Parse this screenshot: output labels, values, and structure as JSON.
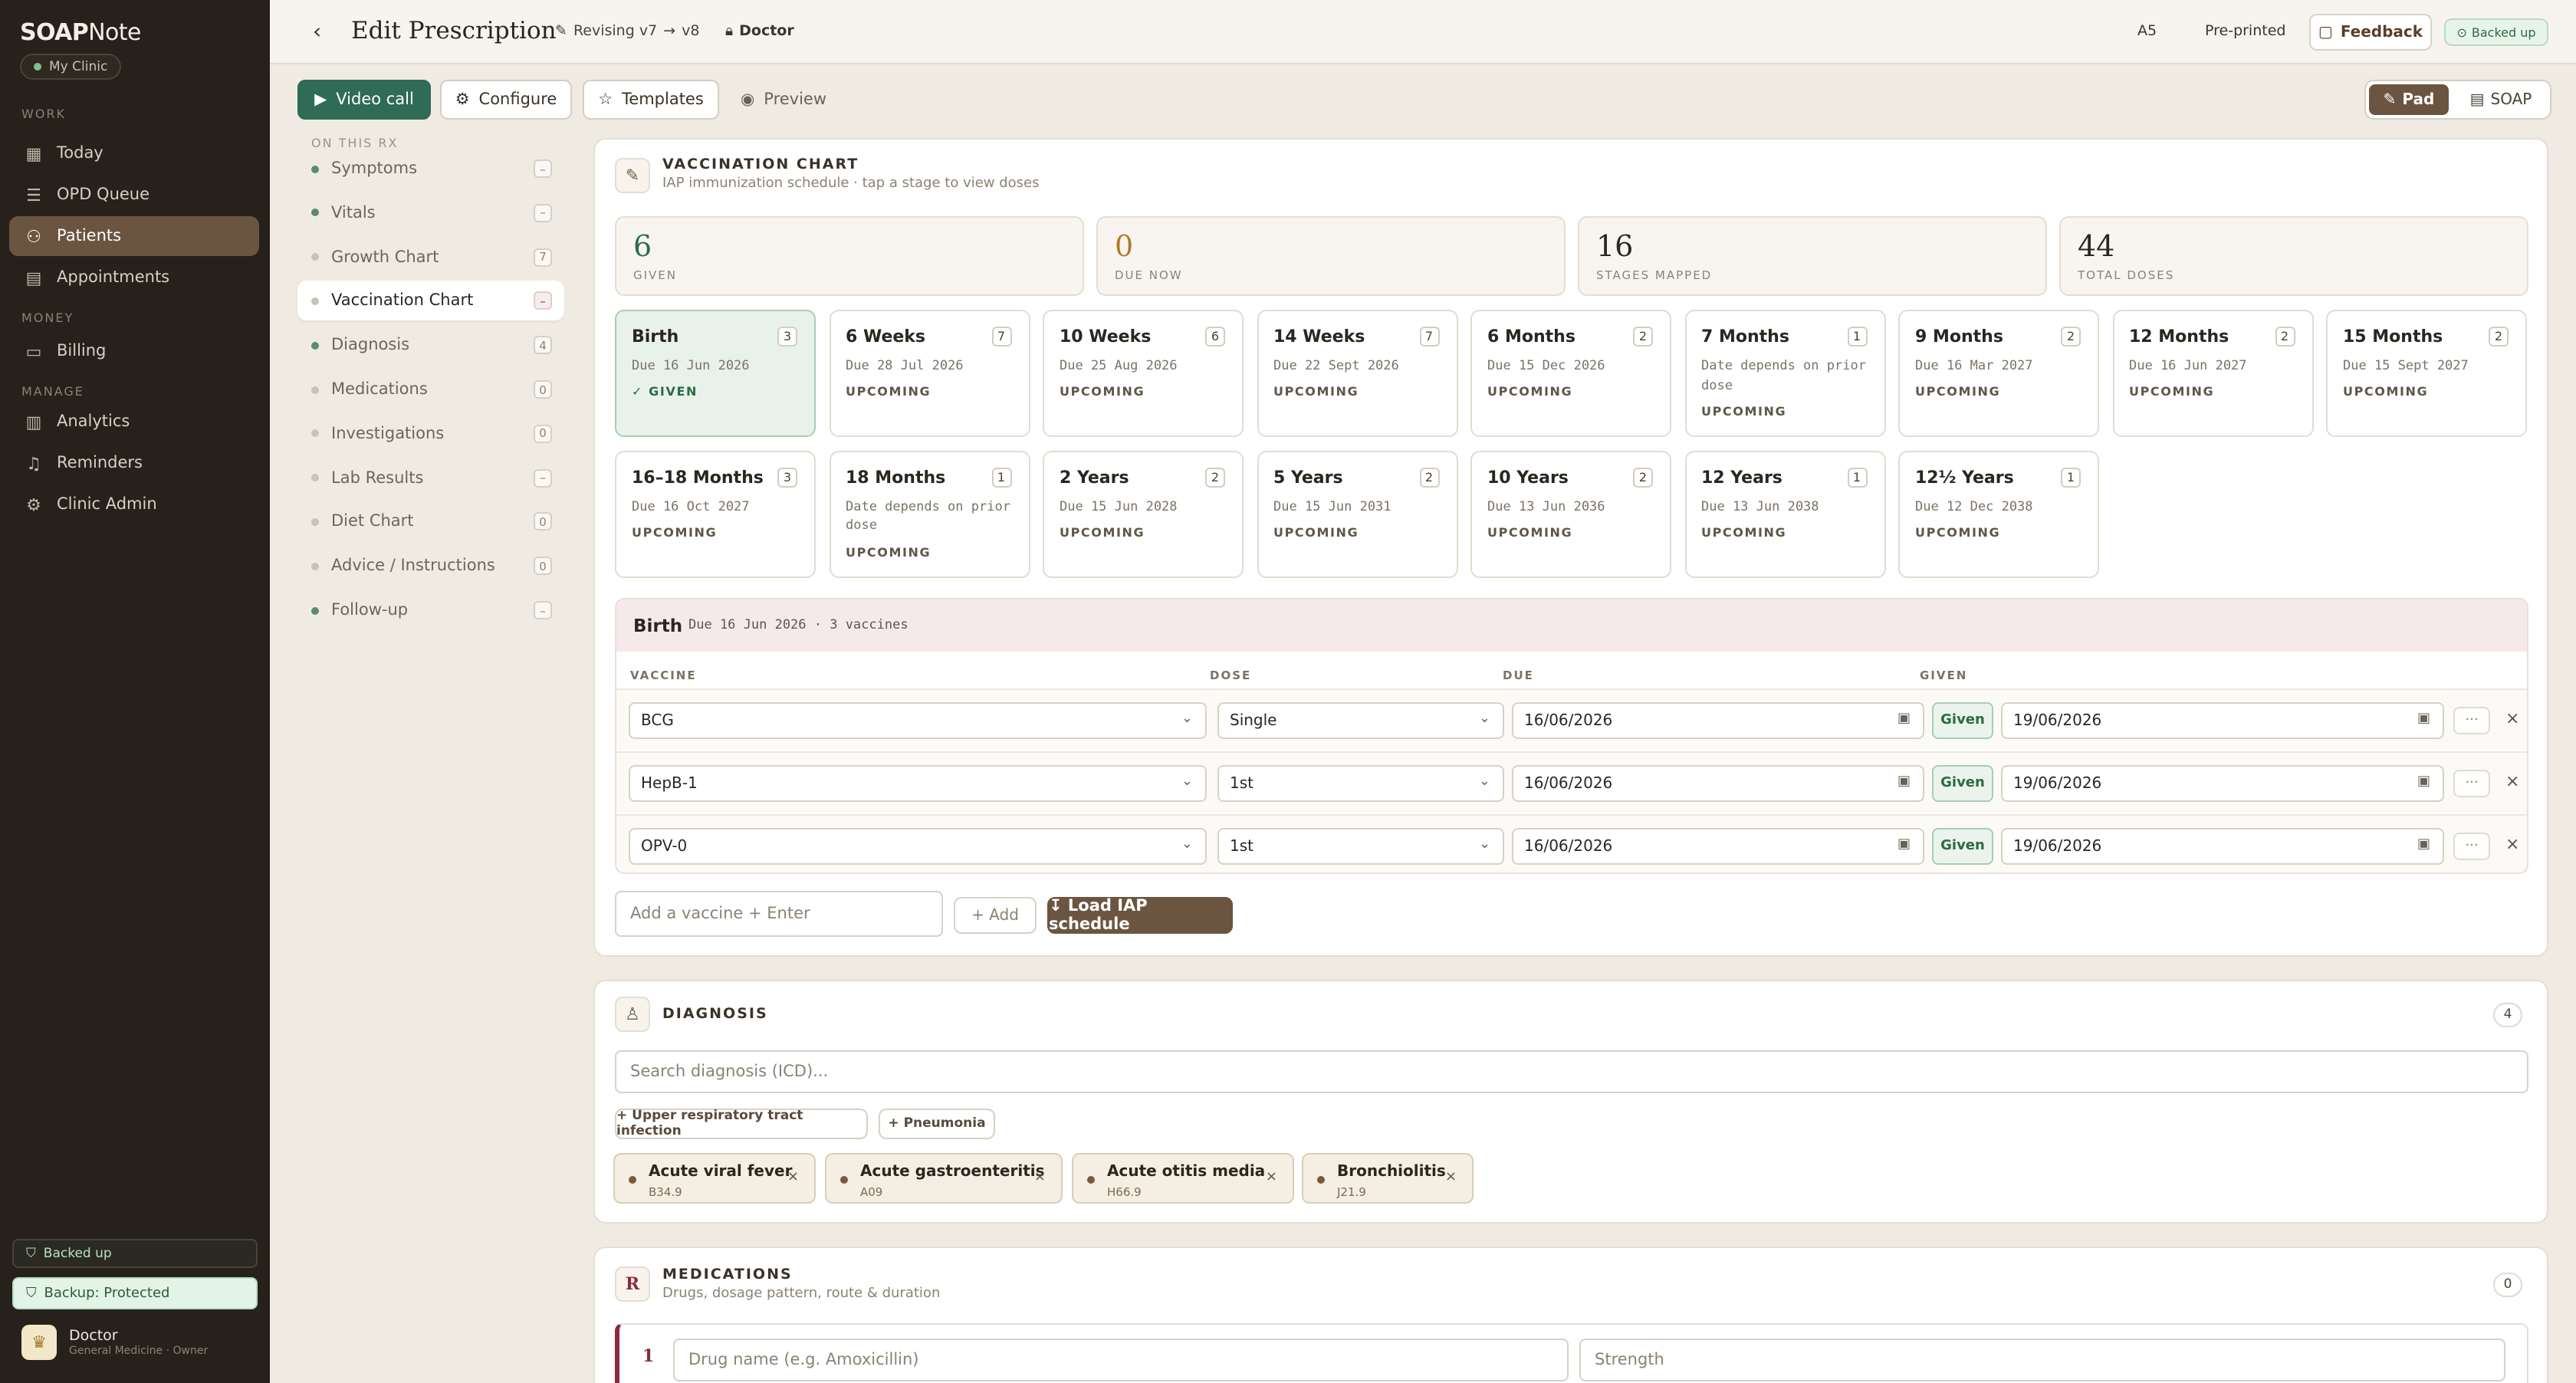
{
  "sidebar": {
    "brand_a": "SOAP",
    "brand_b": "Note",
    "clinic": "My Clinic",
    "sections": [
      "WORK",
      "MONEY",
      "MANAGE"
    ],
    "items": [
      {
        "label": "Today",
        "icon": "grid-icon"
      },
      {
        "label": "OPD Queue",
        "icon": "list-icon"
      },
      {
        "label": "Patients",
        "icon": "users-icon",
        "active": true
      },
      {
        "label": "Appointments",
        "icon": "calendar-icon"
      },
      {
        "label": "Billing",
        "icon": "receipt-icon"
      },
      {
        "label": "Analytics",
        "icon": "bar-chart-icon"
      },
      {
        "label": "Reminders",
        "icon": "bell-icon"
      },
      {
        "label": "Clinic Admin",
        "icon": "gear-icon"
      }
    ],
    "backed_up": "Backed up",
    "backup_protected": "Backup: Protected",
    "user_name": "Doctor",
    "user_role": "General Medicine · Owner"
  },
  "topbar": {
    "title": "Edit Prescription",
    "revising": "Revising v7",
    "arrow": "→",
    "version": "v8",
    "role": "Doctor",
    "paper": "A5",
    "preprinted": "Pre-printed",
    "feedback": "Feedback",
    "backed_up": "Backed up"
  },
  "toolbar": {
    "video_call": "Video call",
    "configure": "Configure",
    "templates": "Templates",
    "preview": "Preview",
    "pad": "Pad",
    "soap": "SOAP"
  },
  "rxnav": {
    "heading": "ON THIS RX",
    "items": [
      {
        "label": "Symptoms",
        "count": "–",
        "filled": true
      },
      {
        "label": "Vitals",
        "count": "–",
        "filled": true
      },
      {
        "label": "Growth Chart",
        "count": "7",
        "filled": false
      },
      {
        "label": "Vaccination Chart",
        "count": "–",
        "filled": false,
        "active": true
      },
      {
        "label": "Diagnosis",
        "count": "4",
        "filled": true
      },
      {
        "label": "Medications",
        "count": "0",
        "filled": false
      },
      {
        "label": "Investigations",
        "count": "0",
        "filled": false
      },
      {
        "label": "Lab Results",
        "count": "–",
        "filled": false
      },
      {
        "label": "Diet Chart",
        "count": "0",
        "filled": false
      },
      {
        "label": "Advice / Instructions",
        "count": "0",
        "filled": false
      },
      {
        "label": "Follow-up",
        "count": "–",
        "filled": true
      }
    ]
  },
  "vaccination": {
    "title": "VACCINATION CHART",
    "subtitle": "IAP immunization schedule · tap a stage to view doses",
    "stats": [
      {
        "value": "6",
        "label": "GIVEN",
        "color": "#2d6b4f"
      },
      {
        "value": "0",
        "label": "DUE NOW",
        "color": "#b07a2a"
      },
      {
        "value": "16",
        "label": "STAGES MAPPED",
        "color": "#2b2620"
      },
      {
        "value": "44",
        "label": "TOTAL DOSES",
        "color": "#2b2620"
      }
    ],
    "stages": [
      {
        "name": "Birth",
        "count": "3",
        "due": "Due 16 Jun 2026",
        "status": "✓ GIVEN",
        "given": true
      },
      {
        "name": "6 Weeks",
        "count": "7",
        "due": "Due 28 Jul 2026",
        "status": "UPCOMING"
      },
      {
        "name": "10 Weeks",
        "count": "6",
        "due": "Due 25 Aug 2026",
        "status": "UPCOMING"
      },
      {
        "name": "14 Weeks",
        "count": "7",
        "due": "Due 22 Sept 2026",
        "status": "UPCOMING"
      },
      {
        "name": "6 Months",
        "count": "2",
        "due": "Due 15 Dec 2026",
        "status": "UPCOMING"
      },
      {
        "name": "7 Months",
        "count": "1",
        "due": "Date depends on prior dose",
        "status": "UPCOMING",
        "two_line": true
      },
      {
        "name": "9 Months",
        "count": "2",
        "due": "Due 16 Mar 2027",
        "status": "UPCOMING"
      },
      {
        "name": "12 Months",
        "count": "2",
        "due": "Due 16 Jun 2027",
        "status": "UPCOMING"
      },
      {
        "name": "15 Months",
        "count": "2",
        "due": "Due 15 Sept 2027",
        "status": "UPCOMING"
      },
      {
        "name": "16–18 Months",
        "count": "3",
        "due": "Due 16 Oct 2027",
        "status": "UPCOMING"
      },
      {
        "name": "18 Months",
        "count": "1",
        "due": "Date depends on prior dose",
        "status": "UPCOMING",
        "two_line": true
      },
      {
        "name": "2 Years",
        "count": "2",
        "due": "Due 15 Jun 2028",
        "status": "UPCOMING"
      },
      {
        "name": "5 Years",
        "count": "2",
        "due": "Due 15 Jun 2031",
        "status": "UPCOMING"
      },
      {
        "name": "10 Years",
        "count": "2",
        "due": "Due 13 Jun 2036",
        "status": "UPCOMING"
      },
      {
        "name": "12 Years",
        "count": "1",
        "due": "Due 13 Jun 2038",
        "status": "UPCOMING"
      },
      {
        "name": "12½ Years",
        "count": "1",
        "due": "Due 12 Dec 2038",
        "status": "UPCOMING"
      }
    ],
    "detail": {
      "stage": "Birth",
      "meta": "Due 16 Jun 2026 · 3 vaccines",
      "columns": [
        "VACCINE",
        "DOSE",
        "DUE",
        "GIVEN"
      ],
      "rows": [
        {
          "vaccine": "BCG",
          "dose": "Single",
          "due": "16/06/2026",
          "status": "Given",
          "given": "19/06/2026"
        },
        {
          "vaccine": "HepB-1",
          "dose": "1st",
          "due": "16/06/2026",
          "status": "Given",
          "given": "19/06/2026"
        },
        {
          "vaccine": "OPV-0",
          "dose": "1st",
          "due": "16/06/2026",
          "status": "Given",
          "given": "19/06/2026"
        }
      ]
    },
    "add_placeholder": "Add a vaccine + Enter",
    "add_label": "+ Add",
    "load_label": "↧ Load IAP schedule"
  },
  "diagnosis": {
    "title": "DIAGNOSIS",
    "count": "4",
    "search_placeholder": "Search diagnosis (ICD)...",
    "suggestions": [
      "+ Upper respiratory tract infection",
      "+ Pneumonia"
    ],
    "items": [
      {
        "name": "Acute viral fever",
        "code": "B34.9"
      },
      {
        "name": "Acute gastroenteritis",
        "code": "A09"
      },
      {
        "name": "Acute otitis media",
        "code": "H66.9"
      },
      {
        "name": "Bronchiolitis",
        "code": "J21.9"
      }
    ]
  },
  "medications": {
    "icon_letter": "R",
    "title": "MEDICATIONS",
    "subtitle": "Drugs, dosage pattern, route & duration",
    "count": "0",
    "row_number": "1",
    "drug_placeholder": "Drug name (e.g. Amoxicillin)",
    "strength_placeholder": "Strength"
  }
}
